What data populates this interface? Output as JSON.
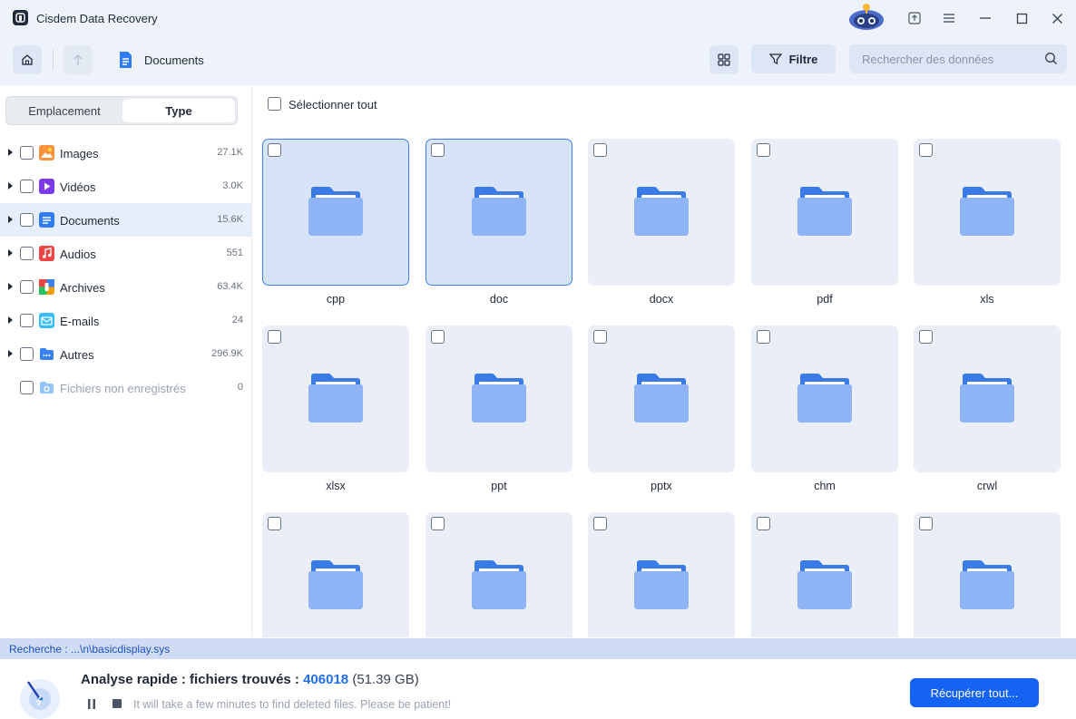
{
  "app": {
    "title": "Cisdem Data Recovery",
    "icons": [
      "app-logo-icon",
      "robot-mascot-icon",
      "upgrade-icon",
      "menu-icon",
      "minimize-icon",
      "maximize-icon",
      "close-icon"
    ]
  },
  "toolbar": {
    "breadcrumb": "Documents",
    "filter_label": "Filtre",
    "search_placeholder": "Rechercher des données"
  },
  "sidebar": {
    "tabs": [
      "Emplacement",
      "Type"
    ],
    "active_tab": "Type",
    "items": [
      {
        "label": "Images",
        "count": "27.1K",
        "icon": "images-icon",
        "color": "#f97316"
      },
      {
        "label": "Vidéos",
        "count": "3.0K",
        "icon": "videos-icon",
        "color": "#7c3aed"
      },
      {
        "label": "Documents",
        "count": "15.6K",
        "icon": "documents-icon",
        "color": "#2f7cf6"
      },
      {
        "label": "Audios",
        "count": "551",
        "icon": "audios-icon",
        "color": "#ef4444"
      },
      {
        "label": "Archives",
        "count": "63.4K",
        "icon": "archives-icon",
        "color": "#f59e0b"
      },
      {
        "label": "E-mails",
        "count": "24",
        "icon": "emails-icon",
        "color": "#38bdf8"
      },
      {
        "label": "Autres",
        "count": "296.9K",
        "icon": "others-icon",
        "color": "#3b82f6"
      },
      {
        "label": "Fichiers non enregistrés",
        "count": "0",
        "icon": "unsaved-files-icon",
        "color": "#93c5fd"
      }
    ]
  },
  "content": {
    "select_all_label": "Sélectionner tout",
    "tiles": [
      "cpp",
      "doc",
      "docx",
      "pdf",
      "xls",
      "xlsx",
      "ppt",
      "pptx",
      "chm",
      "crwl",
      "",
      "",
      "",
      "",
      ""
    ],
    "selected_tiles": [
      "cpp",
      "doc"
    ]
  },
  "status": {
    "path": "Recherche : ...\\n\\basicdisplay.sys"
  },
  "footer": {
    "title_prefix": "Analyse rapide : fichiers trouvés : ",
    "found_count": "406018",
    "size": "(51.39 GB)",
    "hint": "It will take a few minutes to find deleted files. Please be patient!",
    "recover_label": "Récupérer tout...",
    "accent_color": "#1463f3"
  }
}
